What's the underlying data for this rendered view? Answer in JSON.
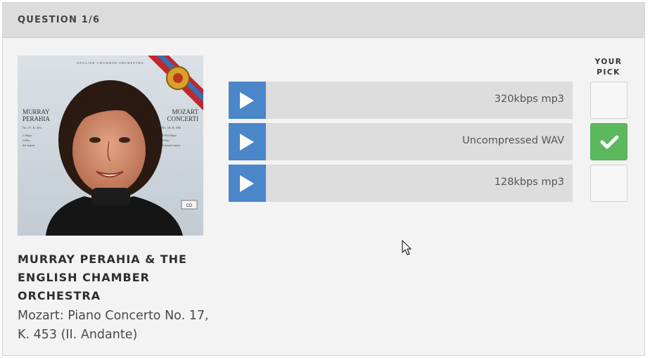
{
  "header": {
    "title": "QUESTION 1/6"
  },
  "album": {
    "cover_icon": "album-cover-image",
    "artist": "MURRAY PERAHIA & THE ENGLISH CHAMBER ORCHESTRA",
    "track": "Mozart: Piano Concerto No. 17, K. 453 (II. Andante)",
    "cover_text": {
      "top_line": "ENGLISH CHAMBER ORCHESTRA",
      "left_name_1": "MURRAY",
      "left_name_2": "PERAHIA",
      "left_detail_1": "No. 17, K. 453",
      "left_detail_2": "G Major",
      "left_detail_3": "G-Dur",
      "left_detail_4": "Sol majeur",
      "right_name_1": "MOZART",
      "right_name_2": "CONCERTI",
      "right_detail_1": "No. 18, K. 456",
      "right_detail_2": "B-Flat Major",
      "right_detail_3": "B-Dur",
      "right_detail_4": "Si bemol majeur"
    }
  },
  "pick_label": "YOUR PICK",
  "options": [
    {
      "label": "320kbps mp3",
      "selected": false
    },
    {
      "label": "Uncompressed WAV",
      "selected": true
    },
    {
      "label": "128kbps mp3",
      "selected": false
    }
  ],
  "colors": {
    "play_button": "#4a86c8",
    "selected_pick": "#5cb85c",
    "row_bg": "#dddddd",
    "header_bg": "#dcdcdc"
  }
}
